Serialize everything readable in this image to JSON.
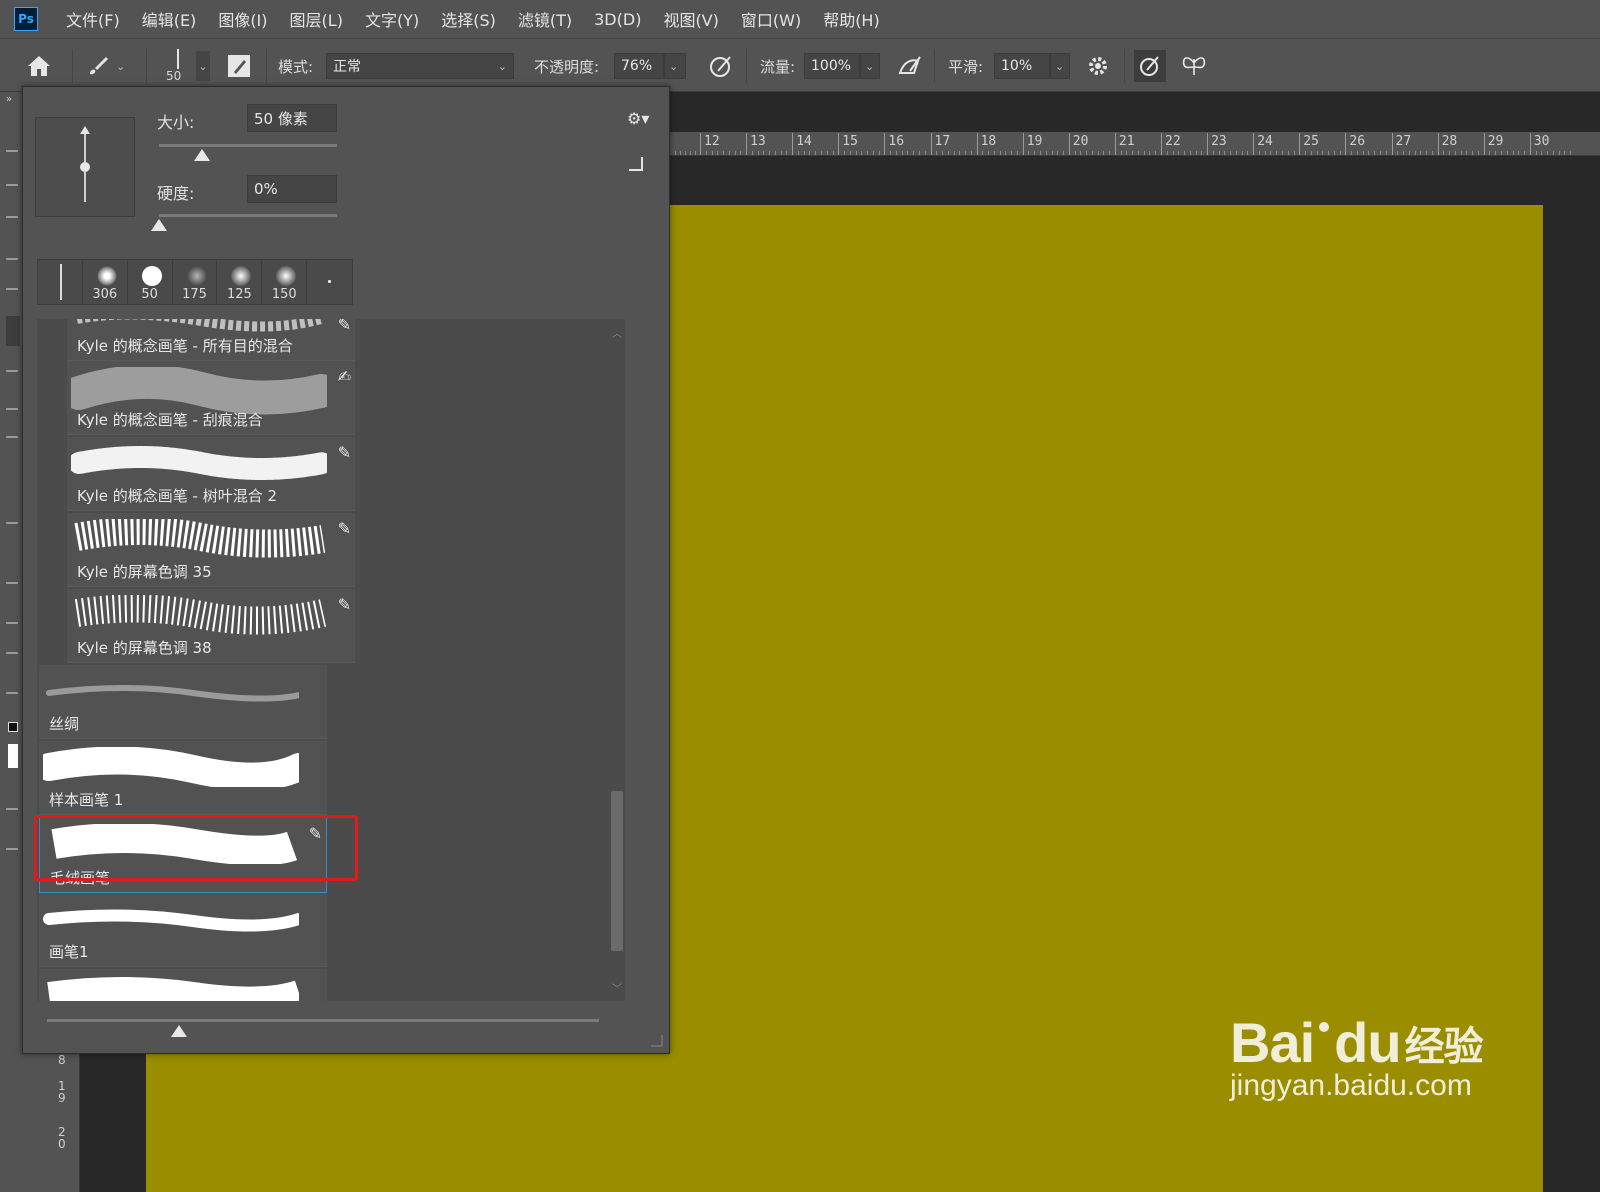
{
  "app": {
    "logo": "Ps"
  },
  "menu": [
    "文件(F)",
    "编辑(E)",
    "图像(I)",
    "图层(L)",
    "文字(Y)",
    "选择(S)",
    "滤镜(T)",
    "3D(D)",
    "视图(V)",
    "窗口(W)",
    "帮助(H)"
  ],
  "options": {
    "brush_size": "50",
    "mode_label": "模式:",
    "mode_value": "正常",
    "opacity_label": "不透明度:",
    "opacity_value": "76%",
    "flow_label": "流量:",
    "flow_value": "100%",
    "smooth_label": "平滑:",
    "smooth_value": "10%"
  },
  "ruler": [
    "12",
    "13",
    "14",
    "15",
    "16",
    "17",
    "18",
    "19",
    "20",
    "21",
    "22",
    "23",
    "24",
    "25",
    "26",
    "27",
    "28",
    "29",
    "30"
  ],
  "vruler": [
    "8",
    "1\n9",
    "2\n0"
  ],
  "panel": {
    "size_label": "大小:",
    "size_value": "50 像素",
    "size_fraction": 0.24,
    "hardness_label": "硬度:",
    "hardness_value": "0%",
    "hardness_fraction": 0.0,
    "recent": [
      "",
      "306",
      "50",
      "175",
      "125",
      "150",
      ""
    ],
    "brushes": [
      {
        "name": "Kyle 的概念画笔 - 所有目的混合",
        "col": 1
      },
      {
        "name": "Kyle 的概念画笔 - 刮痕混合",
        "col": 1
      },
      {
        "name": "Kyle 的概念画笔 - 树叶混合 2",
        "col": 1
      },
      {
        "name": "Kyle 的屏幕色调 35",
        "col": 1
      },
      {
        "name": "Kyle 的屏幕色调 38",
        "col": 1
      },
      {
        "name": "丝绸",
        "col": 0
      },
      {
        "name": "样本画笔 1",
        "col": 0
      },
      {
        "name": "毛绒画笔",
        "col": 0
      },
      {
        "name": "画笔1",
        "col": 0
      }
    ],
    "preview_size_fraction": 0.24
  },
  "colors": {
    "canvas": "#9a8d00",
    "highlight": "#e11b1b"
  },
  "watermark": {
    "brand": "Bai",
    "brand_du": "du",
    "cn": "经验",
    "url": "jingyan.baidu.com"
  }
}
